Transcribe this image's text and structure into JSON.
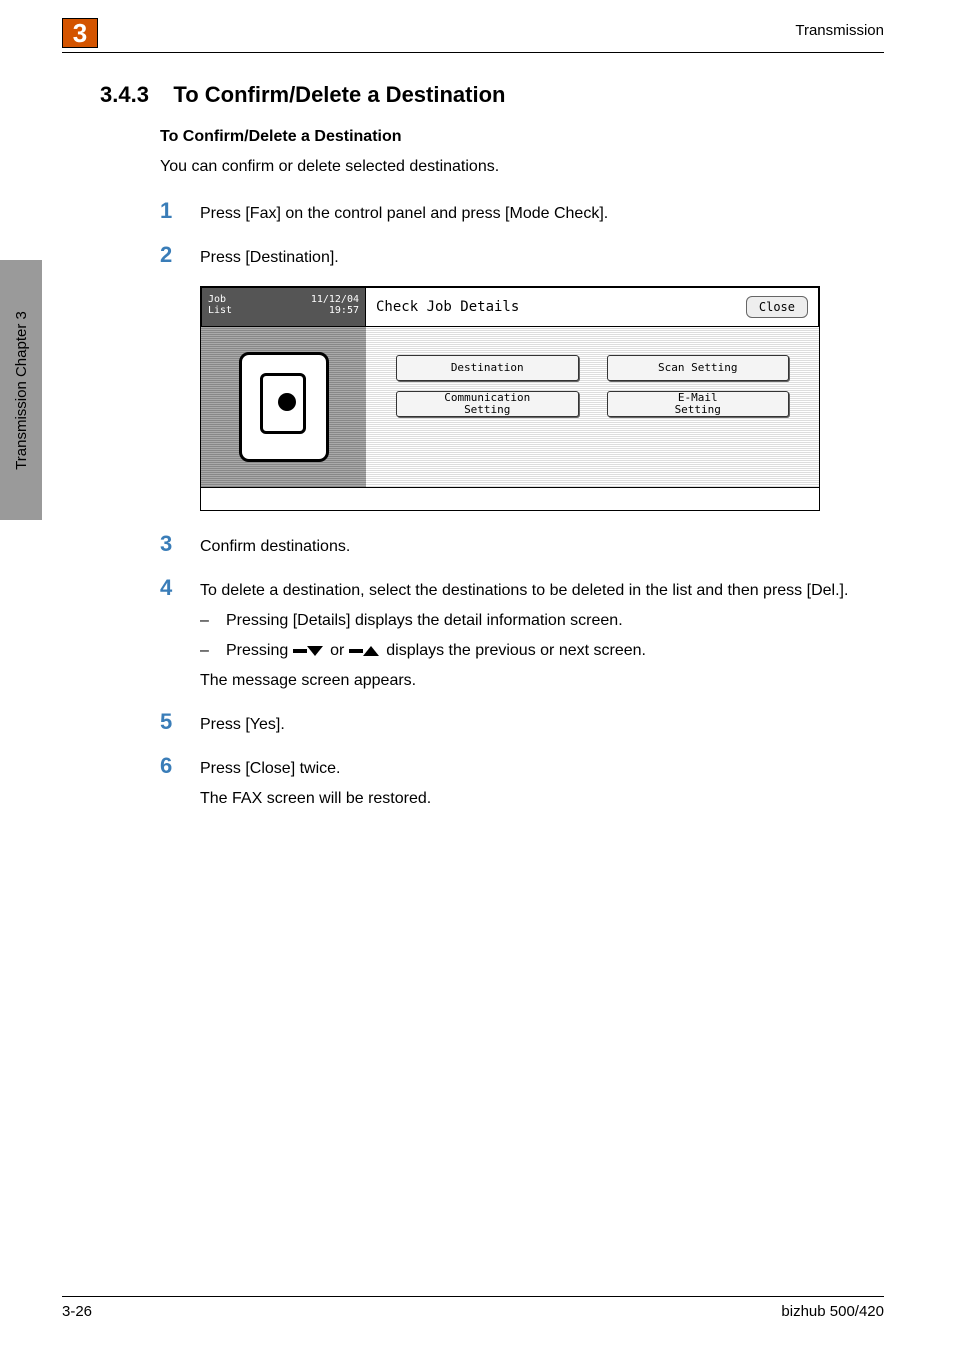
{
  "header": {
    "chapter_num": "3",
    "section_title": "Transmission"
  },
  "side_tab": {
    "label": "Transmission    Chapter 3"
  },
  "section": {
    "number": "3.4.3",
    "title": "To Confirm/Delete a Destination",
    "sub_title": "To Confirm/Delete a Destination",
    "intro": "You can confirm or delete selected destinations."
  },
  "steps": [
    {
      "num": "1",
      "text": "Press [Fax] on the control panel and press [Mode Check]."
    },
    {
      "num": "2",
      "text": "Press [Destination]."
    },
    {
      "num": "3",
      "text": "Confirm destinations."
    },
    {
      "num": "4",
      "text": "To delete a destination, select the destinations to be deleted in the list and then press [Del.].",
      "bullets": [
        "Pressing [Details] displays the detail information screen.",
        "Pressing  ▼  or  ▲  displays the previous or next screen."
      ],
      "sub": "The message screen appears."
    },
    {
      "num": "5",
      "text": "Press [Yes]."
    },
    {
      "num": "6",
      "text": "Press [Close] twice.",
      "sub": "The FAX screen will be restored."
    }
  ],
  "screen": {
    "job_list_label": "Job\nList",
    "job_list_date": "11/12/04",
    "job_list_time": "19:57",
    "title": "Check Job Details",
    "close": "Close",
    "buttons": {
      "destination": "Destination",
      "scan_setting": "Scan Setting",
      "comm_setting": "Communication\nSetting",
      "email_setting": "E-Mail\nSetting"
    }
  },
  "step4_arrows": {
    "prefix": "Pressing ",
    "mid": " or ",
    "suffix": " displays the previous or next screen."
  },
  "footer": {
    "page": "3-26",
    "model": "bizhub 500/420"
  }
}
